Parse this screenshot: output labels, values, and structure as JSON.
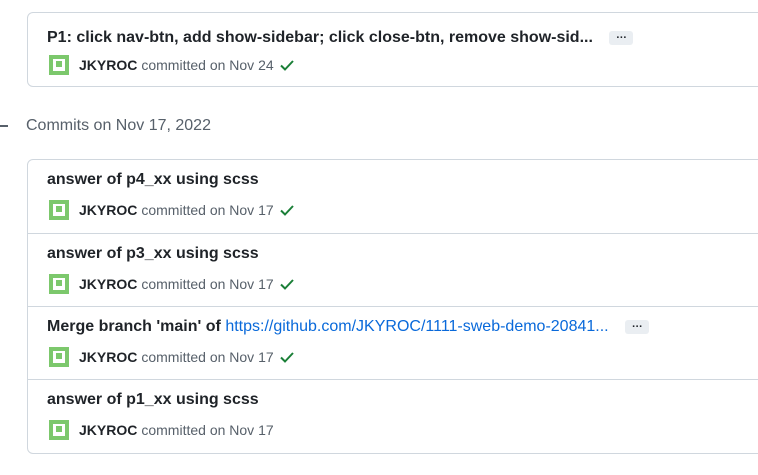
{
  "top_commit": {
    "message": "P1: click nav-btn, add show-sidebar; click close-btn, remove show-sid...",
    "author": "JKYROC",
    "committed_text": "committed on Nov 24",
    "verified": true
  },
  "group_header": "Commits on Nov 17, 2022",
  "commits": [
    {
      "message": "answer of p4_xx using scss",
      "author": "JKYROC",
      "committed_text": "committed on Nov 17",
      "verified": true
    },
    {
      "message": "answer of p3_xx using scss",
      "author": "JKYROC",
      "committed_text": "committed on Nov 17",
      "verified": true
    },
    {
      "message_prefix": "Merge branch 'main' of ",
      "message_link": "https://github.com/JKYROC/1111-sweb-demo-20841...",
      "author": "JKYROC",
      "committed_text": "committed on Nov 17",
      "verified": true
    },
    {
      "message": "answer of p1_xx using scss",
      "author": "JKYROC",
      "committed_text": "committed on Nov 17",
      "verified": false
    }
  ],
  "ellipsis_label": "…",
  "colors": {
    "avatar": "#7cc86c",
    "check": "#1a7f37",
    "link": "#0969da"
  }
}
